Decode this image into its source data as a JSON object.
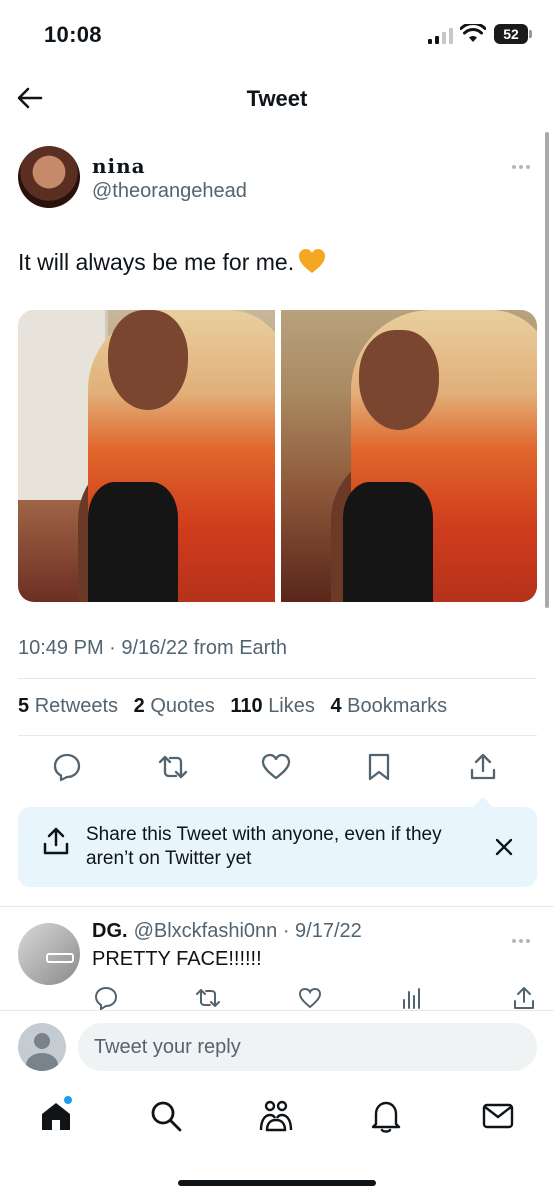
{
  "status_bar": {
    "time": "10:08",
    "battery": "52"
  },
  "header": {
    "title": "Tweet"
  },
  "tweet": {
    "author_name": "nina",
    "author_handle": "@theorangehead",
    "text": "It will always be me for me.",
    "timestamp": "10:49 PM · 9/16/22 from Earth",
    "stats": {
      "retweets_count": "5",
      "retweets_label": "Retweets",
      "quotes_count": "2",
      "quotes_label": "Quotes",
      "likes_count": "110",
      "likes_label": "Likes",
      "bookmarks_count": "4",
      "bookmarks_label": "Bookmarks"
    }
  },
  "share_prompt": {
    "text": "Share this Tweet with anyone, even if they aren’t on Twitter yet"
  },
  "reply": {
    "name": "DG.",
    "handle": "@Blxckfashi0nn",
    "date": "· 9/17/22",
    "text": "PRETTY FACE!!!!!!"
  },
  "compose": {
    "placeholder": "Tweet your reply"
  },
  "colors": {
    "accent": "#1d9bf0",
    "secondary_text": "#536471",
    "share_bg": "#e8f5fd",
    "heart_emoji": "#f5a623"
  },
  "icons": {
    "back": "arrow-left-icon",
    "more": "more-horizontal-icon",
    "reply": "comment-icon",
    "retweet": "retweet-icon",
    "like": "heart-icon",
    "bookmark": "bookmark-icon",
    "share": "share-icon",
    "close": "close-icon",
    "views": "analytics-icon",
    "nav_home": "home-icon",
    "nav_search": "search-icon",
    "nav_communities": "communities-icon",
    "nav_notifications": "bell-icon",
    "nav_messages": "mail-icon"
  }
}
